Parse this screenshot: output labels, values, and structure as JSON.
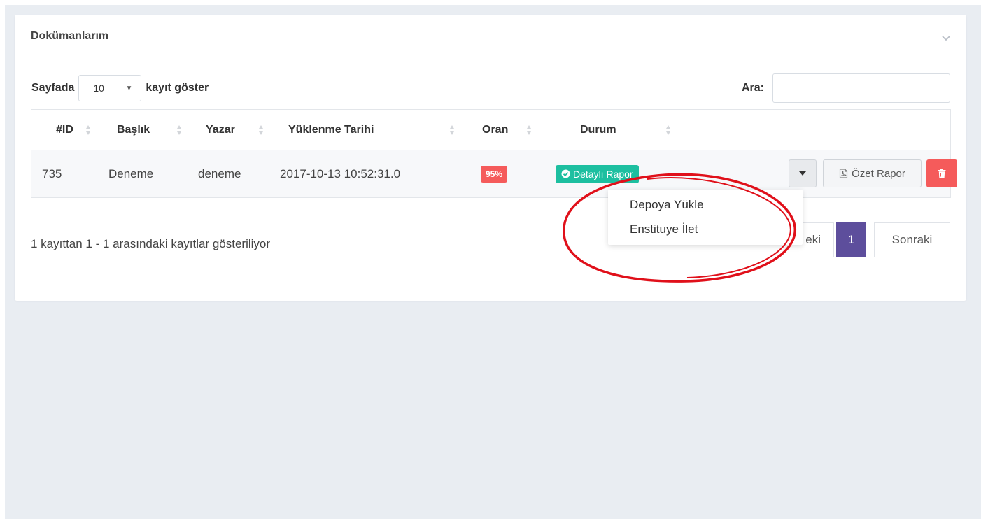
{
  "panel": {
    "title": "Dokümanlarım"
  },
  "length_control": {
    "prefix": "Sayfada",
    "selected": "10",
    "suffix": "kayıt göster"
  },
  "search": {
    "label": "Ara:",
    "value": "",
    "placeholder": ""
  },
  "table": {
    "columns": [
      "#ID",
      "Başlık",
      "Yazar",
      "Yüklenme Tarihi",
      "Oran",
      "Durum"
    ],
    "rows": [
      {
        "id": "735",
        "title": "Deneme",
        "author": "deneme",
        "date": "2017-10-13 10:52:31.0",
        "rate": "95%",
        "status": "Detaylı Rapor"
      }
    ]
  },
  "actions": {
    "summary_label": "Özet Rapor"
  },
  "dropdown": {
    "items": [
      "Depoya Yükle",
      "Enstituye İlet"
    ]
  },
  "footer": {
    "info": "1 kayıttan 1 - 1 arasındaki kayıtlar gösteriliyor"
  },
  "pagination": {
    "prev_visible": "eki",
    "current": "1",
    "next": "Sonraki"
  },
  "colors": {
    "rate_badge": "#f55b5b",
    "status_badge": "#1dbfa0",
    "active_page": "#5d4e9c",
    "annotation_circle": "#e0101a"
  }
}
